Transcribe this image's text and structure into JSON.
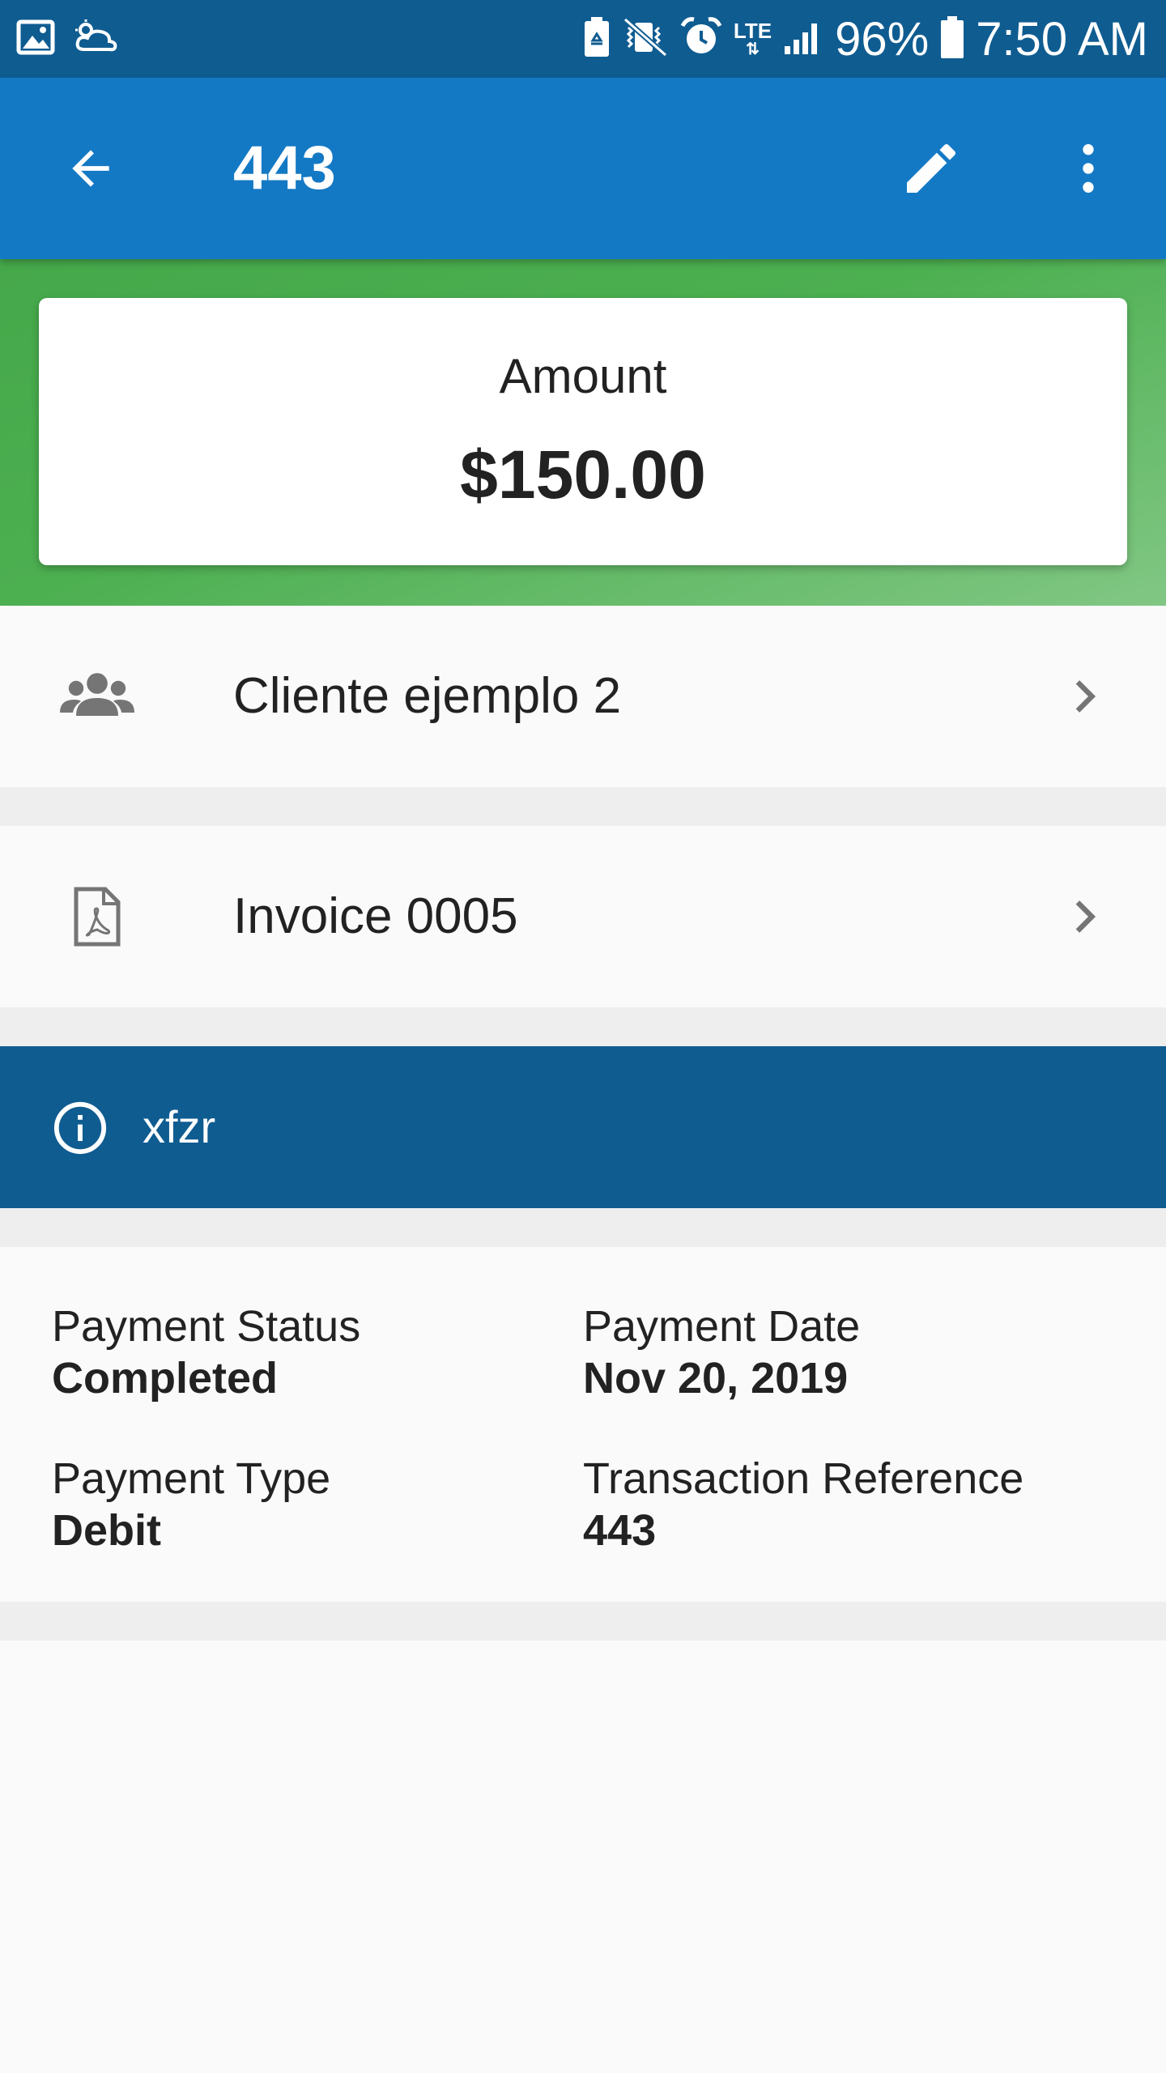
{
  "status_bar": {
    "left_icons": [
      "image-icon",
      "weather-cloud-icon"
    ],
    "right_icons": [
      "battery-saver-icon",
      "vibrate-mute-icon",
      "alarm-icon",
      "lte-icon",
      "signal-icon",
      "battery-icon"
    ],
    "lte_label": "LTE",
    "battery_percent": "96%",
    "time": "7:50 AM"
  },
  "app_bar": {
    "title": "443",
    "back_icon": "arrow-back-icon",
    "edit_icon": "pencil-icon",
    "more_icon": "more-vert-icon"
  },
  "amount_card": {
    "label": "Amount",
    "value": "$150.00"
  },
  "client_row": {
    "icon": "people-icon",
    "label": "Cliente ejemplo 2"
  },
  "invoice_row": {
    "icon": "pdf-file-icon",
    "label": "Invoice 0005"
  },
  "notice": {
    "icon": "info-icon",
    "text": "xfzr"
  },
  "details": {
    "payment_status": {
      "label": "Payment Status",
      "value": "Completed"
    },
    "payment_date": {
      "label": "Payment Date",
      "value": "Nov 20, 2019"
    },
    "payment_type": {
      "label": "Payment Type",
      "value": "Debit"
    },
    "transaction_reference": {
      "label": "Transaction Reference",
      "value": "443"
    }
  },
  "colors": {
    "status_bar": "#0f5c91",
    "app_bar": "#1479c4",
    "hero_green": "#4caf50",
    "notice_bg": "#0f5c91",
    "page_bg": "#fafafa",
    "divider": "#eeeeee"
  }
}
